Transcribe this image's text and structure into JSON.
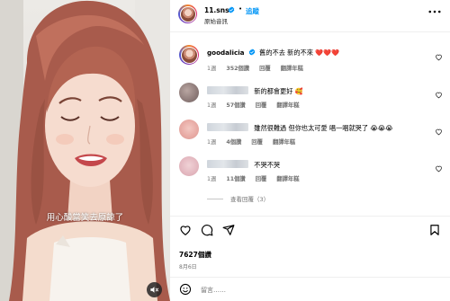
{
  "video": {
    "subtitle": "用心酸當笑去原諒了",
    "mute_icon": "speaker-muted-icon"
  },
  "header": {
    "username": "11.sns",
    "follow_label": "追蹤",
    "audio_label": "原始音訊",
    "separator": "•"
  },
  "comments": [
    {
      "username": "goodalicia",
      "text": "舊的不去 新的不來",
      "emoji": "❤️❤️❤️",
      "time": "1週",
      "likes": "352個讚",
      "reply": "回覆",
      "translate": "翻譯年糕"
    },
    {
      "username": "",
      "text": "新的都會更好",
      "emoji": "🥰",
      "time": "1週",
      "likes": "57個讚",
      "reply": "回覆",
      "translate": "翻譯年糕"
    },
    {
      "username": "",
      "text": "雖然很難過 但你也太可愛 唱一唱就哭了",
      "emoji": "😭😭😭",
      "time": "1週",
      "likes": "4個讚",
      "reply": "回覆",
      "translate": "翻譯年糕"
    },
    {
      "username": "",
      "text": "不哭不哭",
      "emoji": "",
      "time": "1週",
      "likes": "11個讚",
      "reply": "回覆",
      "translate": "翻譯年糕"
    }
  ],
  "view_replies": "查看回覆（3）",
  "post": {
    "likes": "7627個讚",
    "date": "8月6日"
  },
  "comment_box": {
    "placeholder": "留言……",
    "post_label": "發佈"
  },
  "colors": {
    "link_blue": "#0095f6",
    "verified_blue": "#0095f6",
    "heart_red": "#ed4956",
    "meta_gray": "#737373"
  }
}
